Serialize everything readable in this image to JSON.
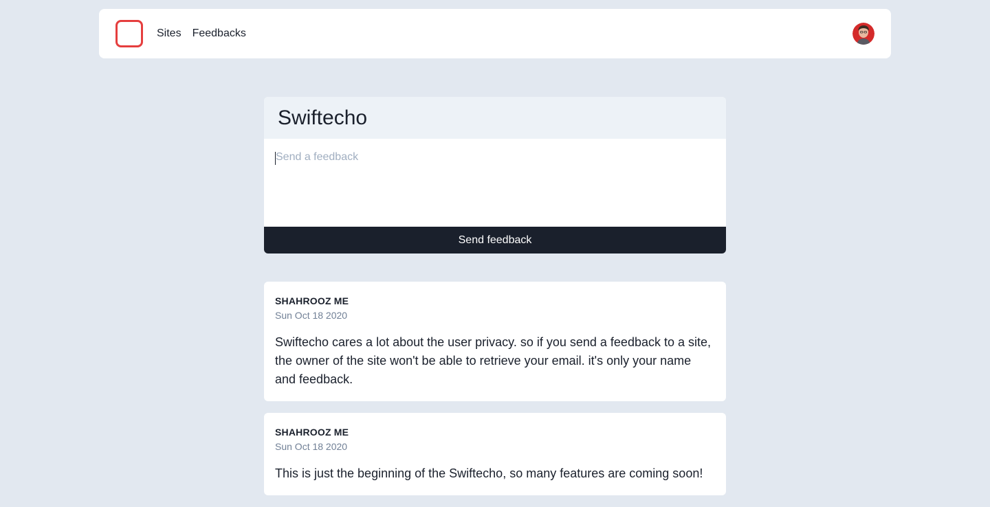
{
  "nav": {
    "links": [
      "Sites",
      "Feedbacks"
    ],
    "logo_color": "#e53e3e",
    "avatar_icon": "user-avatar"
  },
  "site": {
    "title": "Swiftecho",
    "input_placeholder": "Send a feedback",
    "input_value": "",
    "send_label": "Send feedback"
  },
  "feedbacks": [
    {
      "author": "SHAHROOZ ME",
      "date": "Sun Oct 18 2020",
      "text": "Swiftecho cares a lot about the user privacy. so if you send a feedback to a site, the owner of the site won't be able to retrieve your email. it's only your name and feedback."
    },
    {
      "author": "SHAHROOZ ME",
      "date": "Sun Oct 18 2020",
      "text": "This is just the beginning of the Swiftecho, so many features are coming soon!"
    }
  ],
  "colors": {
    "background": "#e2e8f0",
    "button": "#1a202c",
    "header": "#edf2f7"
  }
}
